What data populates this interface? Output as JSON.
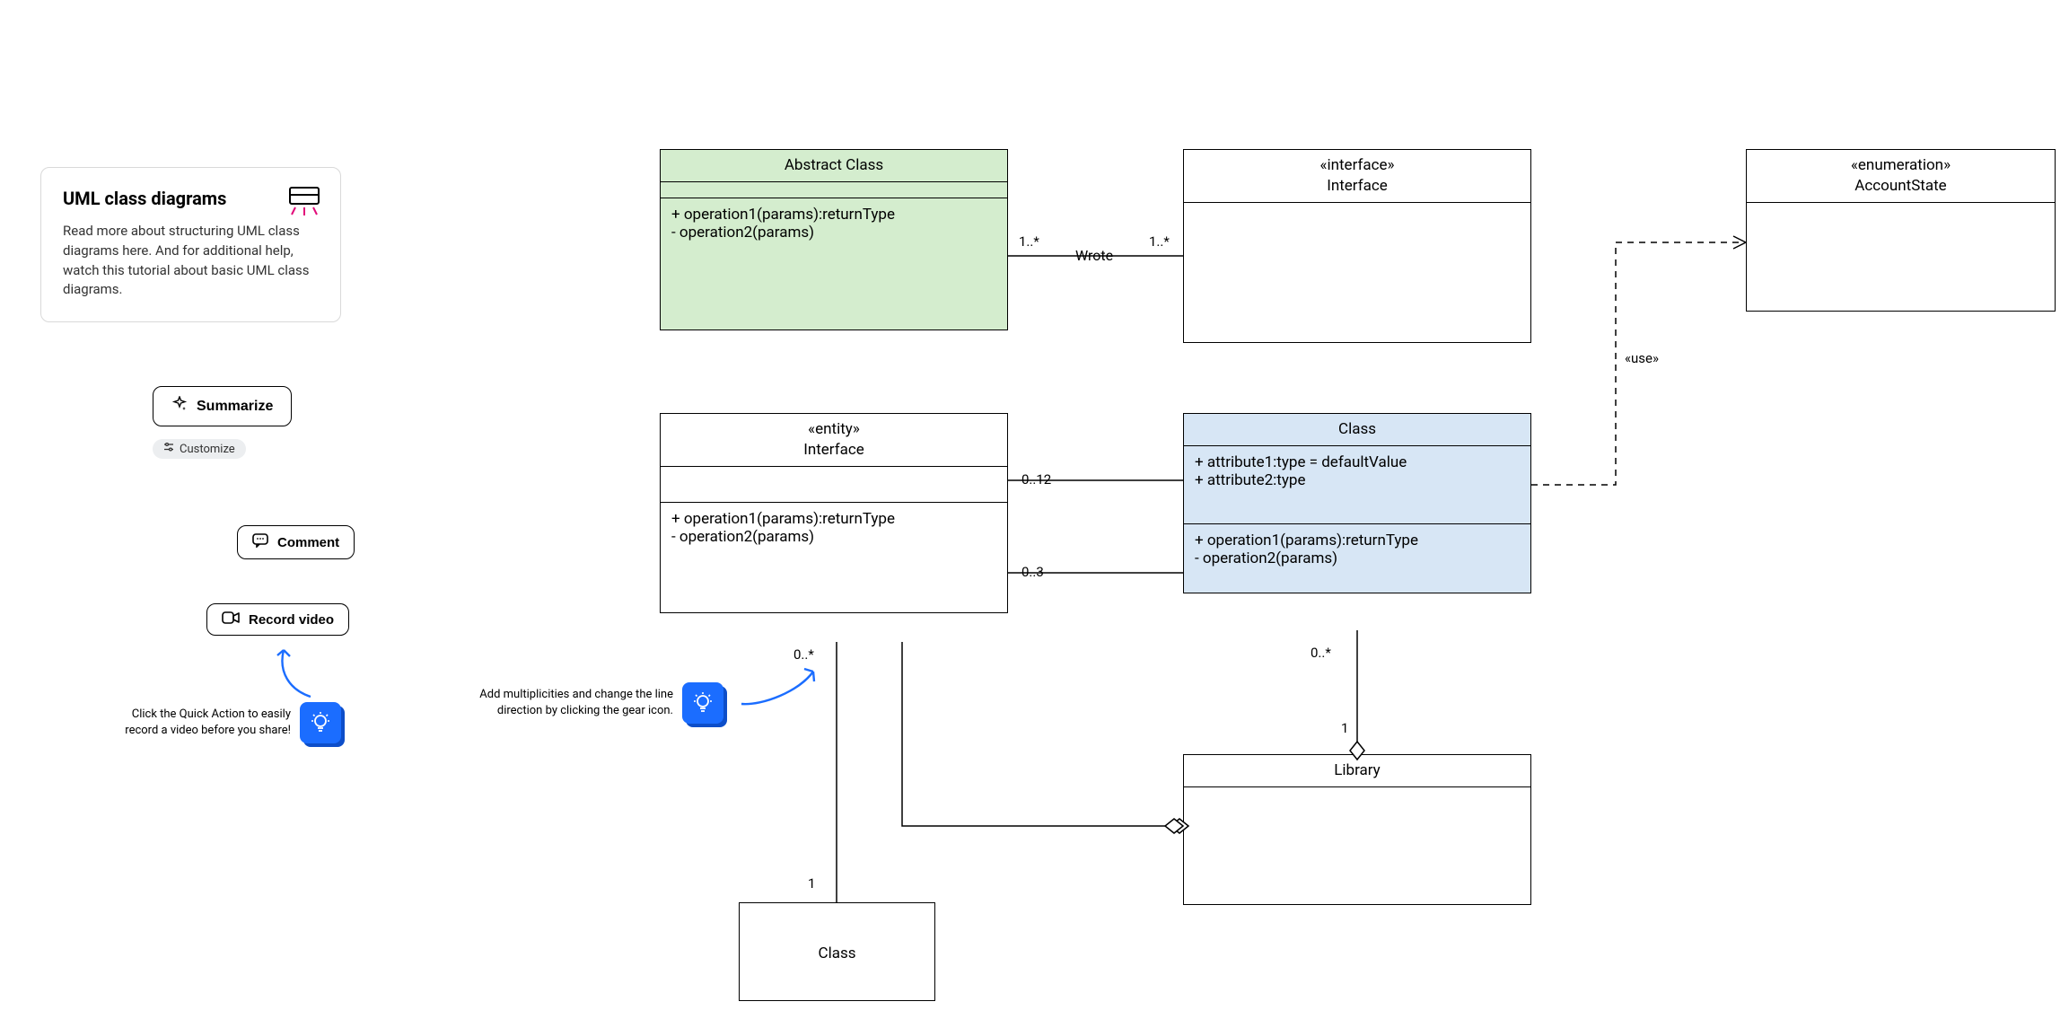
{
  "info_card": {
    "title": "UML class diagrams",
    "body": "Read more about structuring UML class diagrams here. And for additional help, watch this tutorial about basic UML class diagrams."
  },
  "actions": {
    "summarize": "Summarize",
    "customize": "Customize",
    "comment": "Comment",
    "record": "Record video"
  },
  "tips": {
    "record_tip": "Click the Quick Action to easily record a video before you share!",
    "gear_tip": "Add multiplicities and change the line direction by clicking the gear icon."
  },
  "uml": {
    "abstract_class": {
      "title": "Abstract Class",
      "ops": [
        "+ operation1(params):returnType",
        "- operation2(params)"
      ]
    },
    "interface_top": {
      "stereo": "«interface»",
      "name": "Interface"
    },
    "enumeration": {
      "stereo": "«enumeration»",
      "name": "AccountState"
    },
    "entity_interface": {
      "stereo": "«entity»",
      "name": "Interface",
      "ops": [
        "+ operation1(params):returnType",
        "- operation2(params)"
      ]
    },
    "class_main": {
      "title": "Class",
      "attrs": [
        "+ attribute1:type = defaultValue",
        "+ attribute2:type"
      ],
      "ops": [
        "+ operation1(params):returnType",
        "- operation2(params)"
      ]
    },
    "library": {
      "title": "Library"
    },
    "class_bottom": {
      "title": "Class"
    }
  },
  "edges": {
    "abs_to_iface_left": "1..*",
    "abs_to_iface_label": "Wrote",
    "abs_to_iface_right": "1..*",
    "entity_class_top": "0..12",
    "entity_class_mid": "0..3",
    "entity_down": "0..*",
    "class_down": "0..*",
    "class_lib": "1",
    "entity_class_bottom": "1",
    "use_label": "«use»"
  }
}
